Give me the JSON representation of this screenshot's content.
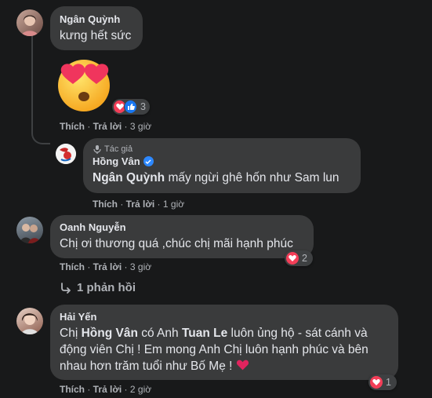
{
  "comments": [
    {
      "author": "Ngân Quỳnh",
      "text": "kưng hết sức",
      "reaction_count": "3",
      "actions": {
        "like": "Thích",
        "reply": "Trả lời",
        "time": "3 giờ"
      }
    },
    {
      "badge": "Tác giả",
      "author": "Hồng Vân",
      "mention": "Ngân Quỳnh",
      "text": "mấy ngừi ghê hốn như Sam lun",
      "actions": {
        "like": "Thích",
        "reply": "Trả lời",
        "time": "1 giờ"
      }
    },
    {
      "author": "Oanh Nguyễn",
      "text": "Chị ơi thương quá ,chúc chị mãi hạnh phúc",
      "reaction_count": "2",
      "actions": {
        "like": "Thích",
        "reply": "Trả lời",
        "time": "3 giờ"
      },
      "replies_label": "1 phản hồi"
    },
    {
      "author": "Hải Yến",
      "text_parts": {
        "p1": "Chị ",
        "m1": "Hồng Vân",
        "p2": " có Anh ",
        "m2": "Tuan Le",
        "p3": " luôn ủng hộ - sát cánh và động viên Chị ! Em mong Anh Chị luôn hạnh phúc và bên nhau hơn trăm tuổi như Bố Mẹ ! "
      },
      "reaction_count": "1",
      "actions": {
        "like": "Thích",
        "reply": "Trả lời",
        "time": "2 giờ"
      }
    }
  ],
  "colors": {
    "background": "#18191a",
    "bubble": "#3a3b3c",
    "text": "#e4e6eb",
    "secondary_text": "#b0b3b8",
    "heart": "#f33e58",
    "like": "#1877f2"
  },
  "icons": [
    "heart-eyes-emoji",
    "love-reaction-icon",
    "like-reaction-icon",
    "mic-icon",
    "verified-badge-icon",
    "reply-arrow-icon",
    "red-heart-emoji"
  ]
}
